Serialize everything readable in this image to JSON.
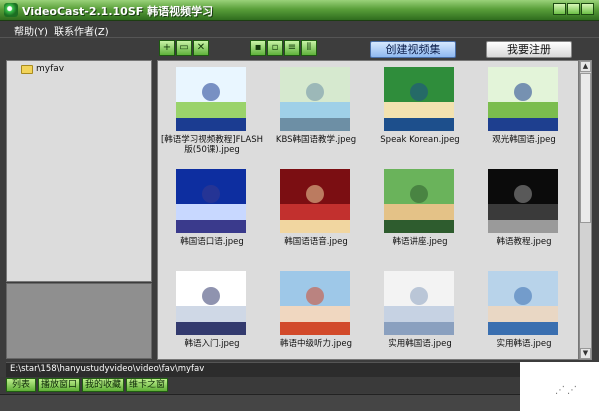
{
  "window": {
    "title": "VideoCast-2.1.10SF 韩语视频学习"
  },
  "menu": {
    "items": [
      "帮助(Y)",
      "联系作者(Z)"
    ]
  },
  "toolbar": {
    "create_label": "创建视频集",
    "register_label": "我要注册"
  },
  "tree": {
    "items": [
      {
        "label": "myfav"
      }
    ]
  },
  "thumbs": [
    {
      "caption": "[韩语学习视频教程]FLASH版(50课).jpeg",
      "colors": [
        "#e9f6ff",
        "#9ad36b",
        "#1b3c91"
      ]
    },
    {
      "caption": "KBS韩国语教学.jpeg",
      "colors": [
        "#d6e9cf",
        "#9fd0e8",
        "#6d8fa5"
      ]
    },
    {
      "caption": "Speak Korean.jpeg",
      "colors": [
        "#2f8d3b",
        "#f2e2b0",
        "#1d4f8c"
      ]
    },
    {
      "caption": "观光韩国语.jpeg",
      "colors": [
        "#e3f4d9",
        "#7bbd4e",
        "#1e3f8f"
      ]
    },
    {
      "caption": "韩国语口语.jpeg",
      "colors": [
        "#0d2ea0",
        "#c8d8ff",
        "#3a3a8c"
      ]
    },
    {
      "caption": "韩国语语音.jpeg",
      "colors": [
        "#7b0e12",
        "#c2302e",
        "#f1d6a0"
      ]
    },
    {
      "caption": "韩语讲座.jpeg",
      "colors": [
        "#6ab35b",
        "#e4c287",
        "#2e5c2e"
      ]
    },
    {
      "caption": "韩语教程.jpeg",
      "colors": [
        "#0b0b0b",
        "#3a3a3a",
        "#9a9a9a"
      ]
    },
    {
      "caption": "韩语入门.jpeg",
      "colors": [
        "#ffffff",
        "#cfd8e6",
        "#333a6e"
      ]
    },
    {
      "caption": "韩语中级听力.jpeg",
      "colors": [
        "#9ec8e8",
        "#f0d7c0",
        "#d24a2a"
      ]
    },
    {
      "caption": "实用韩国语.jpeg",
      "colors": [
        "#f3f3f3",
        "#c6d2e3",
        "#8aa0bf"
      ]
    },
    {
      "caption": "实用韩语.jpeg",
      "colors": [
        "#b8d3ea",
        "#e9d7c4",
        "#3a6fb0"
      ]
    }
  ],
  "path": {
    "text": "E:\\star\\158\\hanyustudyvideo\\video\\fav\\myfav"
  },
  "bottom_tabs": [
    "列表",
    "播放窗口",
    "我的收藏",
    "维卡之窗"
  ]
}
